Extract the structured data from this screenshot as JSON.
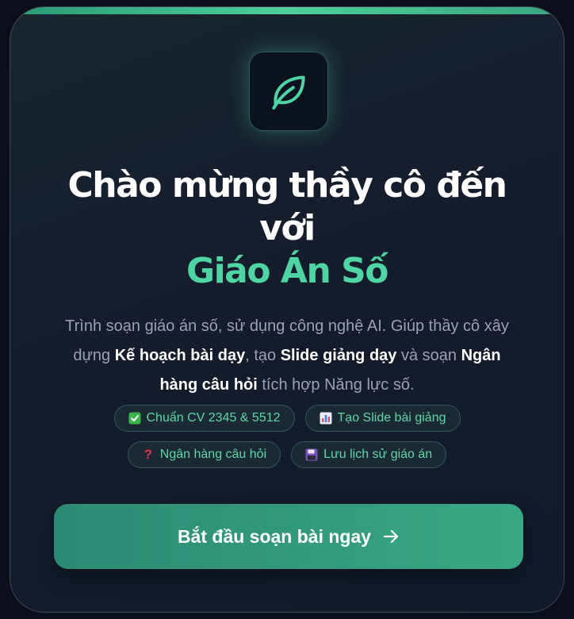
{
  "hero": {
    "logo_icon": "leaf-icon",
    "title_line": "Chào mừng thầy cô đến với",
    "brand": "Giáo Án Số"
  },
  "description": {
    "part1": "Trình soạn giáo án số, sử dụng công nghệ AI. Giúp thầy cô xây dựng ",
    "lesson_plan": "Kế hoạch bài dạy",
    "part2": ", tạo ",
    "slides": "Slide giảng dạy",
    "part3": " và soạn ",
    "question_bank": "Ngân hàng câu hỏi",
    "part4": " tích hợp Năng lực số."
  },
  "badges": [
    {
      "icon": "check-box-icon",
      "label": "Chuẩn CV 2345 & 5512"
    },
    {
      "icon": "bar-chart-icon",
      "label": "Tạo Slide bài giảng"
    },
    {
      "icon": "question-mark-icon",
      "label": "Ngân hàng câu hỏi"
    },
    {
      "icon": "floppy-disk-icon",
      "label": "Lưu lịch sử giáo án"
    }
  ],
  "cta": {
    "label": "Bắt đầu soạn bài ngay",
    "icon": "arrow-right-icon"
  },
  "colors": {
    "accent": "#4fd4a4",
    "button": "#34a07e",
    "background": "#151c2c"
  }
}
